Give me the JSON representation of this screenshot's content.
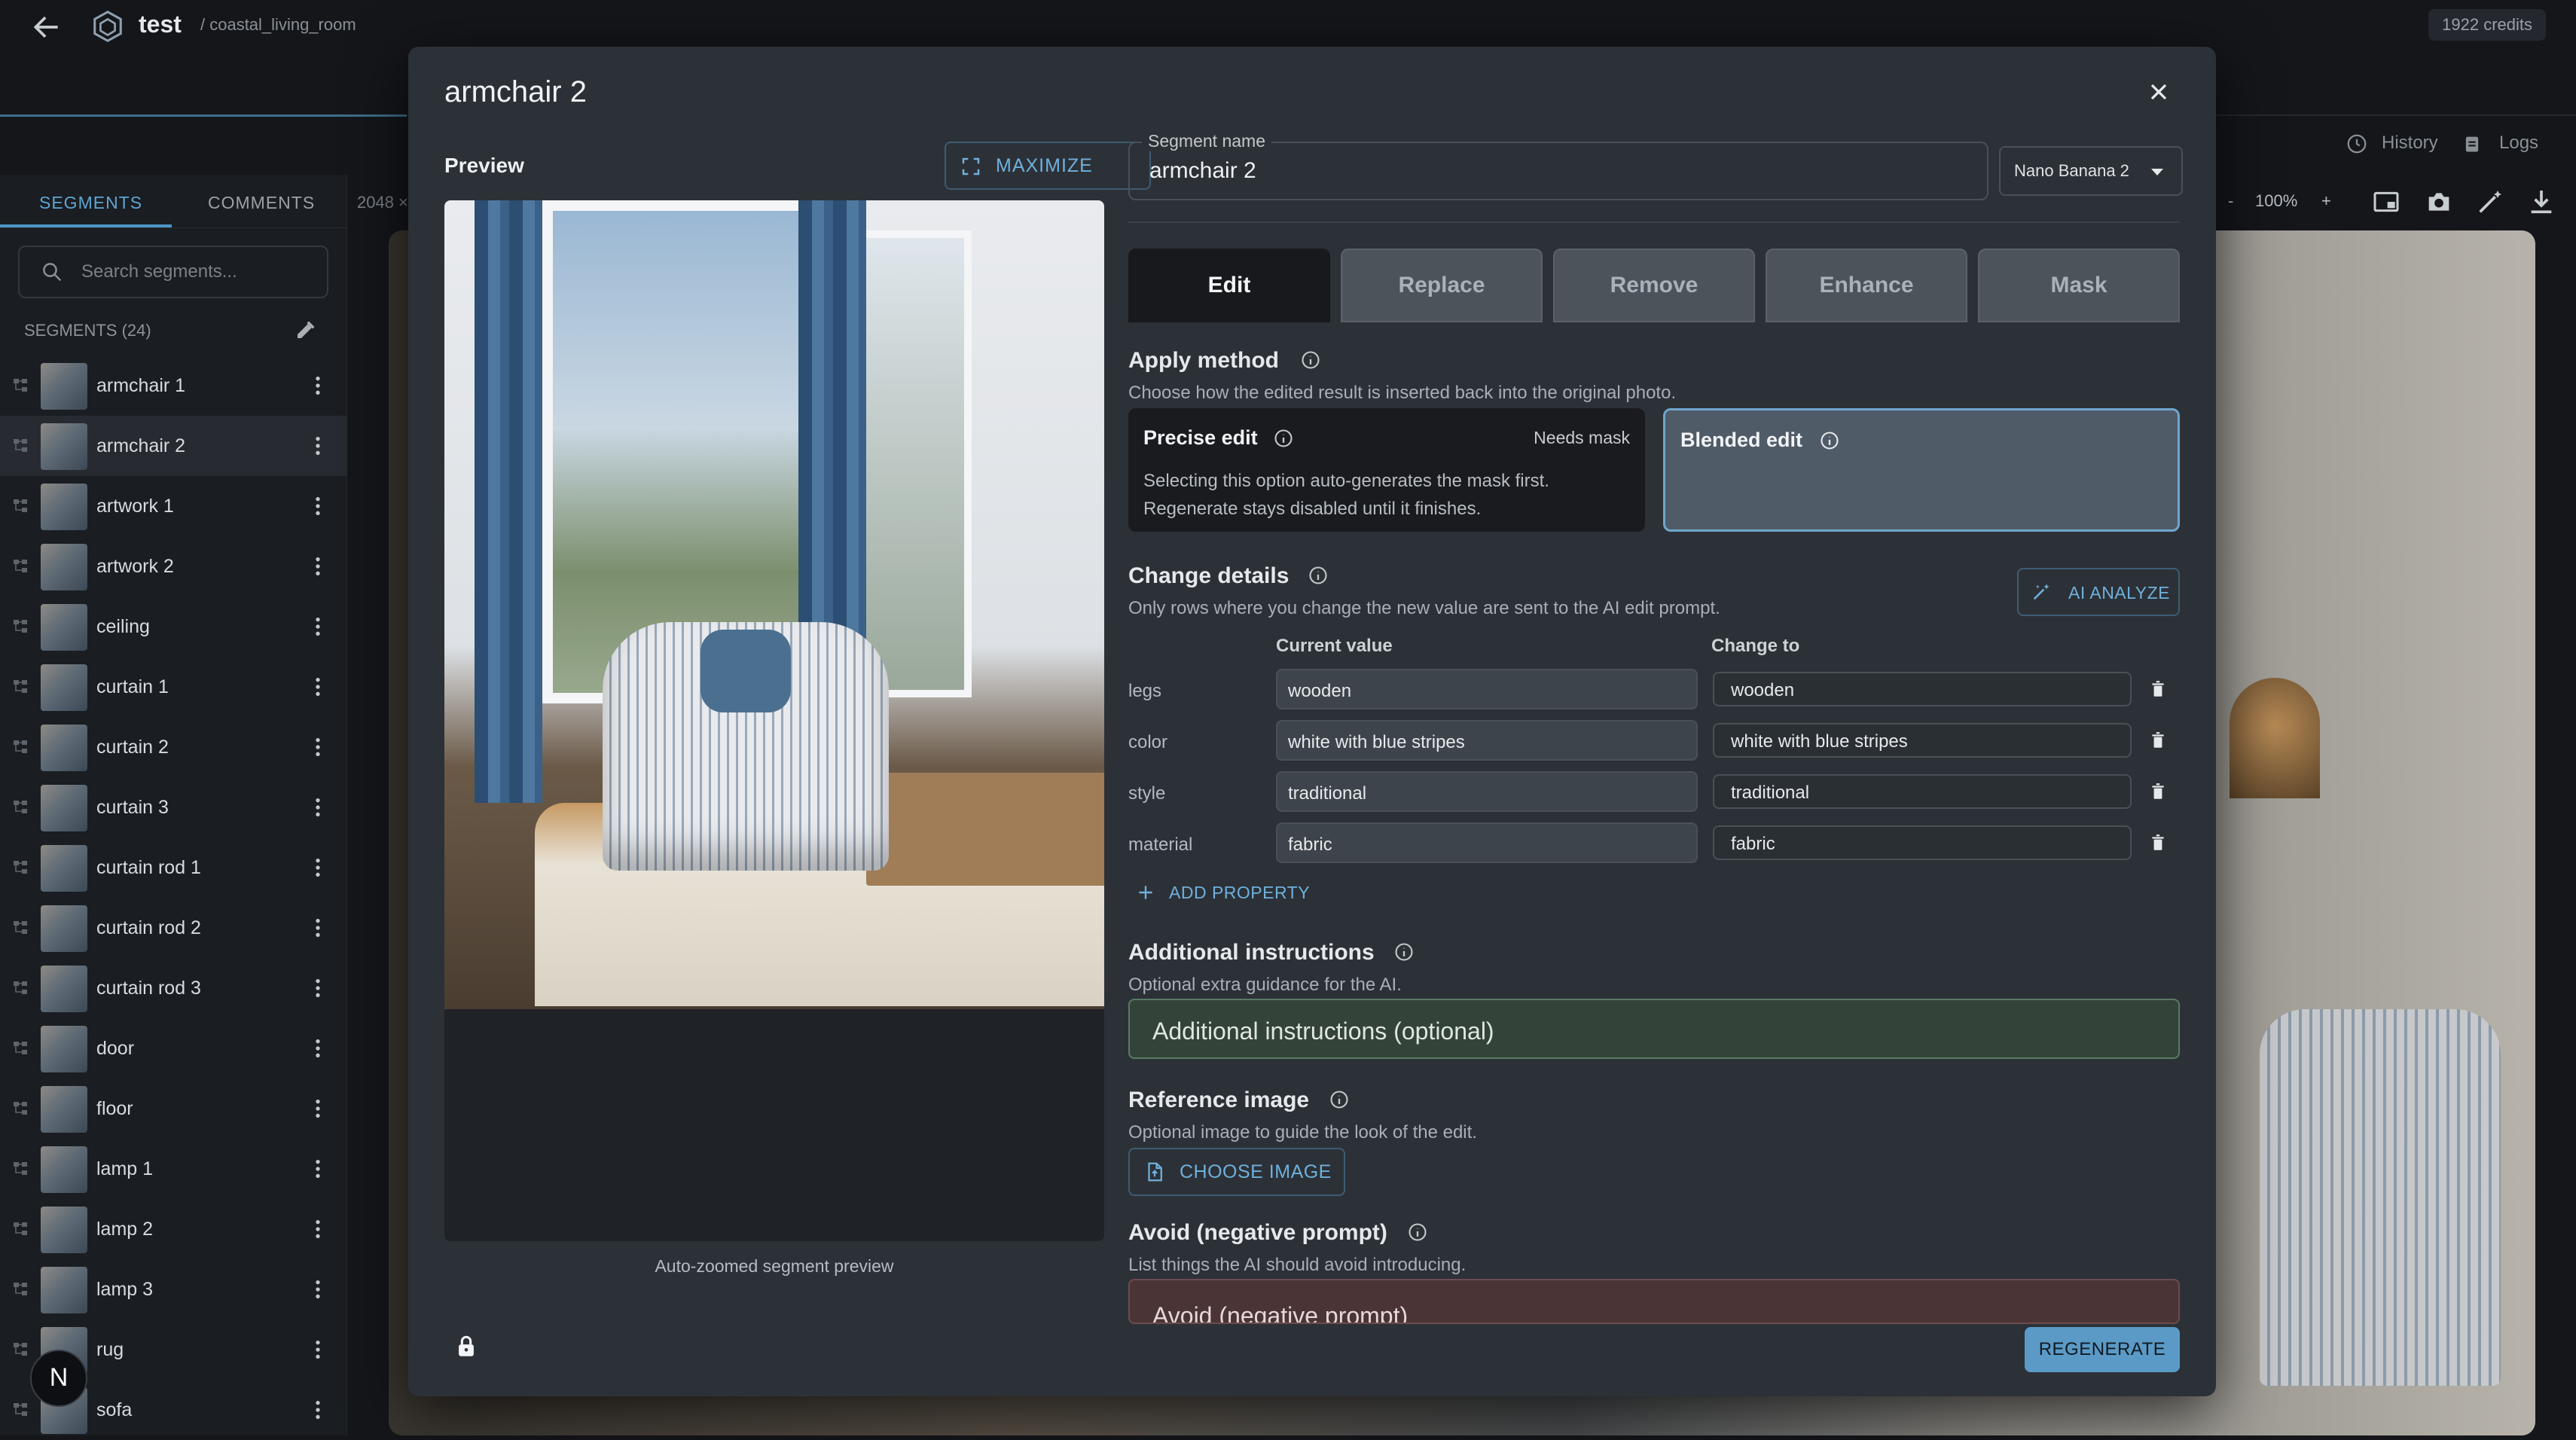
{
  "topbar": {
    "project": "test",
    "breadcrumb": "/ coastal_living_room",
    "credits": "1922 credits"
  },
  "header_right": {
    "history": "History",
    "logs": "Logs",
    "zoom": "100%",
    "zoom_minus": "-",
    "zoom_plus": "+",
    "canvas_dim": "2048 ×"
  },
  "sidebar": {
    "tabs": [
      "SEGMENTS",
      "COMMENTS"
    ],
    "search_placeholder": "Search segments...",
    "segments_header": "SEGMENTS (24)",
    "segments": [
      {
        "label": "armchair 1"
      },
      {
        "label": "armchair 2"
      },
      {
        "label": "artwork 1"
      },
      {
        "label": "artwork 2"
      },
      {
        "label": "ceiling"
      },
      {
        "label": "curtain 1"
      },
      {
        "label": "curtain 2"
      },
      {
        "label": "curtain 3"
      },
      {
        "label": "curtain rod 1"
      },
      {
        "label": "curtain rod 2"
      },
      {
        "label": "curtain rod 3"
      },
      {
        "label": "door"
      },
      {
        "label": "floor"
      },
      {
        "label": "lamp 1"
      },
      {
        "label": "lamp 2"
      },
      {
        "label": "lamp 3"
      },
      {
        "label": "rug"
      },
      {
        "label": "sofa"
      }
    ],
    "active_segment": "armchair 2",
    "nav_badge": "N"
  },
  "modal": {
    "title": "armchair 2",
    "preview_label": "Preview",
    "maximize_label": "MAXIMIZE",
    "preview_caption": "Auto-zoomed segment preview",
    "segment_name_label": "Segment name",
    "segment_name_value": "armchair 2",
    "model": "Nano Banana 2",
    "tabs": [
      "Edit",
      "Replace",
      "Remove",
      "Enhance",
      "Mask"
    ],
    "active_tab": "Edit",
    "apply_method": {
      "title": "Apply method",
      "subtitle": "Choose how the edited result is inserted back into the original photo.",
      "precise": {
        "title": "Precise edit",
        "badge": "Needs mask",
        "description": "Selecting this option auto-generates the mask first. Regenerate stays disabled until it finishes."
      },
      "blended": {
        "title": "Blended edit"
      },
      "selected": "Blended edit"
    },
    "change_details": {
      "title": "Change details",
      "subtitle": "Only rows where you change the new value are sent to the AI edit prompt.",
      "ai_analyze": "AI ANALYZE",
      "col_current": "Current value",
      "col_change": "Change to",
      "rows": [
        {
          "property": "legs",
          "current": "wooden",
          "change": "wooden"
        },
        {
          "property": "color",
          "current": "white with blue stripes",
          "change": "white with blue stripes"
        },
        {
          "property": "style",
          "current": "traditional",
          "change": "traditional"
        },
        {
          "property": "material",
          "current": "fabric",
          "change": "fabric"
        }
      ],
      "add_property": "ADD PROPERTY"
    },
    "additional": {
      "title": "Additional instructions",
      "subtitle": "Optional extra guidance for the AI.",
      "placeholder": "Additional instructions (optional)"
    },
    "reference": {
      "title": "Reference image",
      "subtitle": "Optional image to guide the look of the edit.",
      "button": "CHOOSE IMAGE"
    },
    "avoid": {
      "title": "Avoid (negative prompt)",
      "subtitle": "List things the AI should avoid introducing.",
      "placeholder": "Avoid (negative prompt)"
    },
    "regenerate": "REGENERATE"
  },
  "colors": {
    "accent": "#5ea5d3",
    "modal_bg": "#2c3137",
    "page_bg": "#14161a",
    "selected_card_border": "#6fa6cd",
    "additional_bg": "#334339",
    "avoid_bg": "#4a3436",
    "regenerate_bg": "#5b9ac6"
  },
  "icons": {
    "back": "arrow-left-icon",
    "logo": "cube-logo-icon",
    "close": "close-icon",
    "maximize": "expand-icon",
    "info": "info-circle-icon",
    "ai": "magic-wand-icon",
    "delete": "trash-icon",
    "add": "plus-icon",
    "file": "file-image-icon",
    "lock": "lock-icon",
    "search": "search-icon",
    "more": "more-vertical-icon",
    "history": "history-icon",
    "logs": "clipboard-icon"
  }
}
